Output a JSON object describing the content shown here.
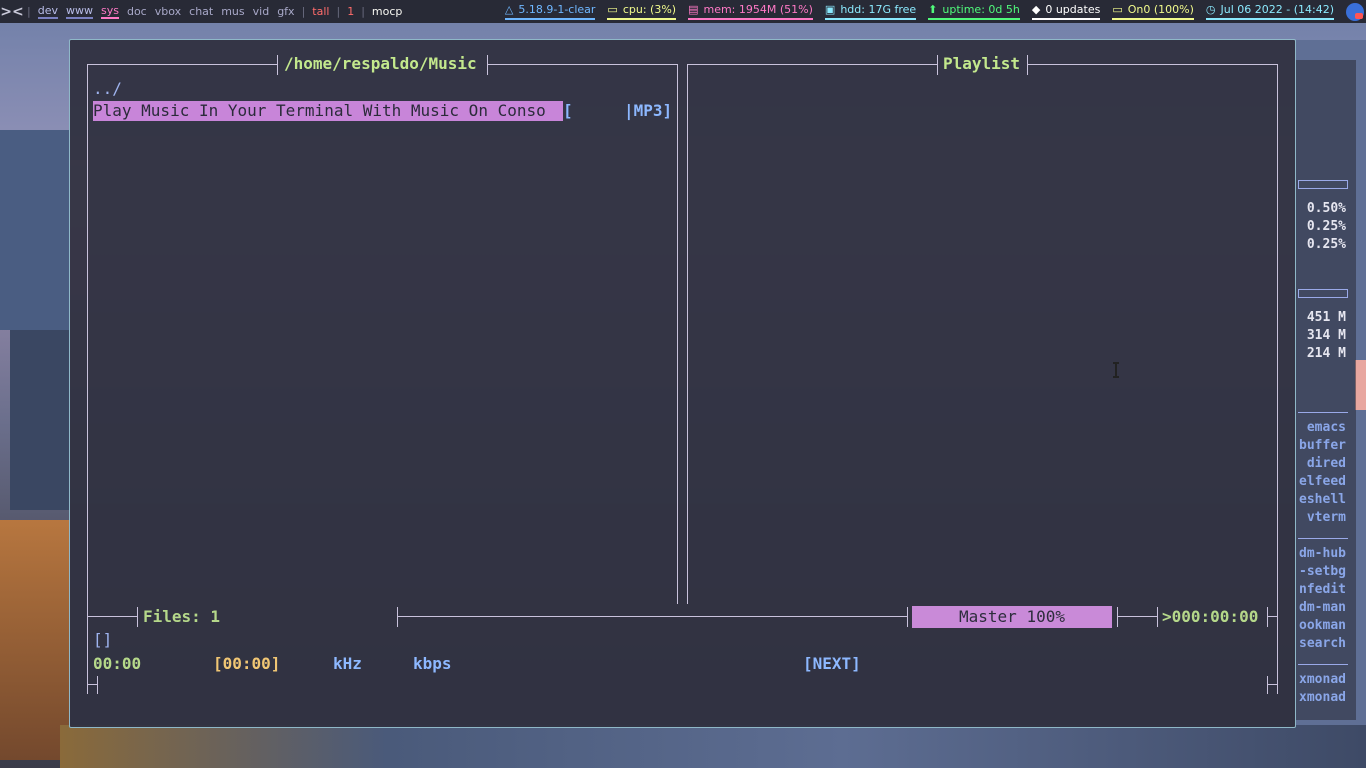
{
  "topbar": {
    "workspaces": [
      {
        "label": "dev",
        "state": "visible"
      },
      {
        "label": "www",
        "state": "visible"
      },
      {
        "label": "sys",
        "state": "current"
      },
      {
        "label": "doc",
        "state": "normal"
      },
      {
        "label": "vbox",
        "state": "normal"
      },
      {
        "label": "chat",
        "state": "normal"
      },
      {
        "label": "mus",
        "state": "normal"
      },
      {
        "label": "vid",
        "state": "normal"
      },
      {
        "label": "gfx",
        "state": "normal"
      }
    ],
    "layout": "tall",
    "window_count": "1",
    "window_title": "mocp",
    "status": {
      "kernel": "5.18.9-1-clear",
      "cpu": "cpu: (3%)",
      "mem": "mem: 1954M (51%)",
      "hdd": "hdd: 17G free",
      "uptime": "uptime: 0d 5h",
      "updates": "0 updates",
      "battery": "On0 (100%)",
      "clock": "Jul 06 2022 - (14:42)"
    },
    "icons": [
      "xmonad-logo-icon",
      "linux-icon",
      "monitor-icon",
      "memory-icon",
      "disk-icon",
      "uptime-arrow-icon",
      "bell-icon",
      "battery-icon",
      "clock-icon",
      "tray-app-icon"
    ]
  },
  "conky": {
    "cpu_values": [
      "0.50%",
      "0.25%",
      "0.25%"
    ],
    "mem_values": [
      "451 M",
      "314 M",
      "214 M"
    ],
    "apps_group1": [
      "emacs",
      "buffer",
      "dired",
      "elfeed",
      "eshell",
      "vterm"
    ],
    "apps_group2": [
      "dm-hub",
      "-setbg",
      "nfedit",
      "dm-man",
      "ookman",
      "search"
    ],
    "apps_group3": [
      "xmonad",
      "xmonad"
    ]
  },
  "mocp": {
    "left_title": "/home/respaldo/Music",
    "right_title": "Playlist",
    "parent_dir": "../",
    "file_name": "Play Music In Your Terminal With Music On Conso",
    "file_bracket": "[",
    "file_type": "|MP3]",
    "files_count": "Files: 1",
    "volume": "Master 100%",
    "total_time": ">000:00:00",
    "state_brackets": "[]",
    "elapsed": "00:00",
    "duration": "[00:00]",
    "khz": "kHz",
    "kbps": "kbps",
    "next": "[NEXT]"
  }
}
